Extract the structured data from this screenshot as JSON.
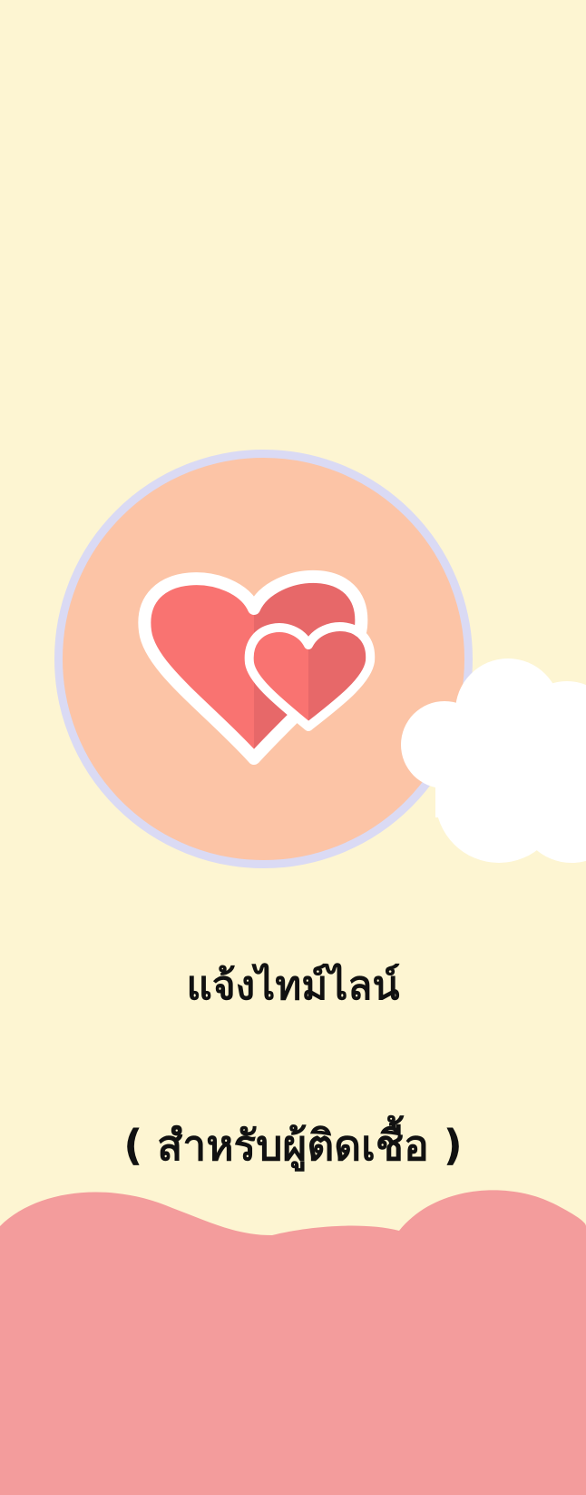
{
  "screen": {
    "title": "แจ้งไทม์ไลน์",
    "subtitle": "( สำหรับผู้ติดเชื้อ )"
  },
  "colors": {
    "background": "#FDF5D2",
    "circle_fill": "#FCC4A6",
    "circle_ring": "#DADAF4",
    "heart_light": "#F97371",
    "heart_dark": "#E76869",
    "heart_outline": "#FFFFFF",
    "cloud": "#FFFFFF",
    "bottom_hill": "#F39C9C"
  },
  "icons": {
    "main": "two-hearts-icon",
    "decor": "cloud-icon"
  }
}
